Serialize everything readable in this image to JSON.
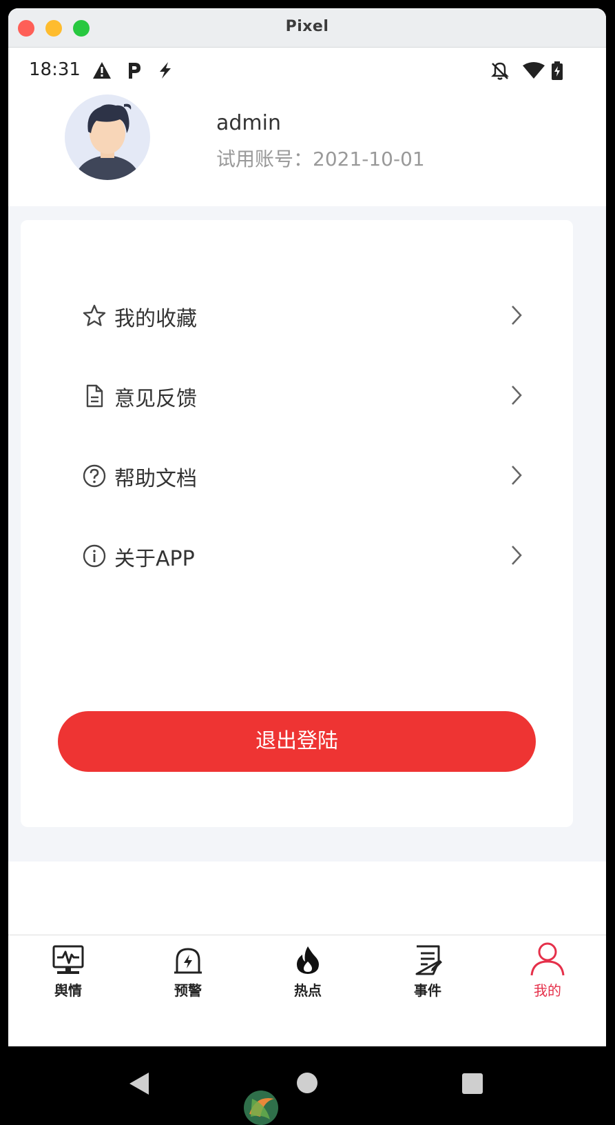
{
  "window": {
    "title": "Pixel"
  },
  "status_bar": {
    "time": "18:31",
    "left_icons": [
      "warning-icon",
      "parking-icon",
      "bolt-icon"
    ],
    "right_icons": [
      "bell-off-icon",
      "wifi-icon",
      "battery-icon"
    ]
  },
  "profile": {
    "username": "admin",
    "trial_label": "试用账号：2021-10-01"
  },
  "menu": {
    "items": [
      {
        "icon": "star-icon",
        "label": "我的收藏"
      },
      {
        "icon": "document-icon",
        "label": "意见反馈"
      },
      {
        "icon": "help-icon",
        "label": "帮助文档"
      },
      {
        "icon": "info-icon",
        "label": "关于APP"
      }
    ]
  },
  "logout_label": "退出登陆",
  "tabs": [
    {
      "icon": "monitor-icon",
      "label": "舆情",
      "active": false
    },
    {
      "icon": "alarm-icon",
      "label": "预警",
      "active": false
    },
    {
      "icon": "fire-icon",
      "label": "热点",
      "active": false
    },
    {
      "icon": "event-icon",
      "label": "事件",
      "active": false
    },
    {
      "icon": "person-icon",
      "label": "我的",
      "active": true
    }
  ],
  "colors": {
    "accent": "#ee3433",
    "active_tab": "#e5304a",
    "background": "#f3f5f9"
  }
}
